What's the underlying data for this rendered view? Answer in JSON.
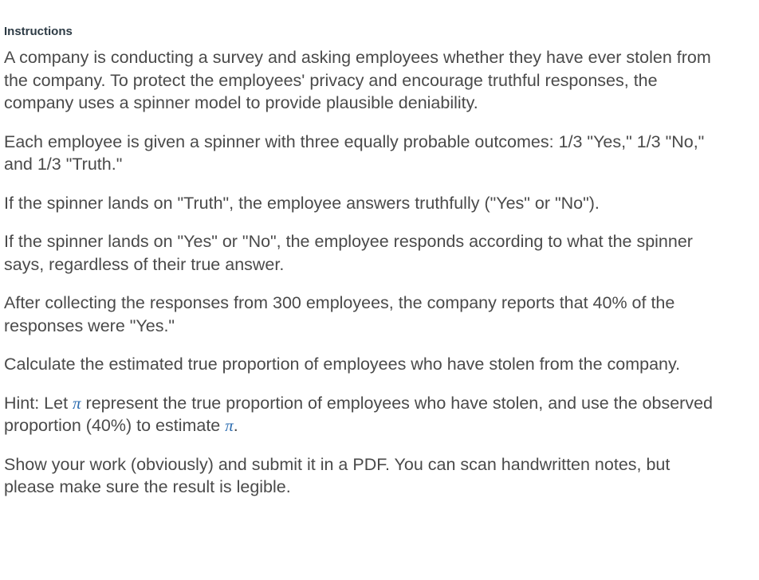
{
  "instructions": {
    "heading": "Instructions",
    "paragraphs": [
      "A company is conducting a survey and asking employees whether they have ever stolen from the company.  To protect the employees' privacy and encourage truthful responses, the company uses a spinner model to provide plausible deniability.",
      "Each employee is given a spinner with three equally probable outcomes: 1/3 \"Yes,\" 1/3 \"No,\" and 1/3 \"Truth.\"",
      "If the spinner lands on \"Truth\", the employee answers truthfully (\"Yes\" or \"No\").",
      "If the spinner lands on \"Yes\" or \"No\", the employee responds according to what the spinner says, regardless of their true answer.",
      "After collecting the responses from 300 employees, the company reports that 40% of the responses were \"Yes.\"",
      "Calculate the estimated true proportion of employees who have stolen from the company."
    ],
    "hint": {
      "part1": "Hint: Let ",
      "symbol": "π",
      "part2": " represent the true proportion of employees who have stolen, and use the observed proportion (40%) to estimate ",
      "symbol2": "π",
      "part3": "."
    },
    "final": "Show your work (obviously) and submit it in a PDF. You can scan handwritten notes, but please make sure the result is legible."
  }
}
